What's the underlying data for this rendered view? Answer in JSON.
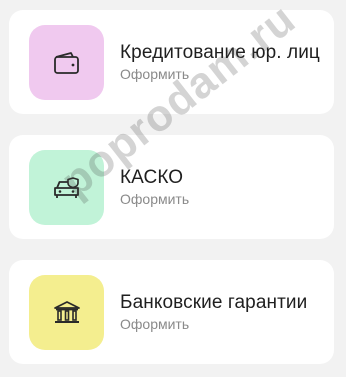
{
  "items": [
    {
      "title": "Кредитование юр. лиц",
      "action": "Оформить",
      "icon": "wallet-icon",
      "color": "#f0c9ef"
    },
    {
      "title": "КАСКО",
      "action": "Оформить",
      "icon": "car-shield-icon",
      "color": "#c1f3d8"
    },
    {
      "title": "Банковские гарантии",
      "action": "Оформить",
      "icon": "bank-icon",
      "color": "#f4ee8f"
    }
  ],
  "watermark": "poprodam.ru"
}
